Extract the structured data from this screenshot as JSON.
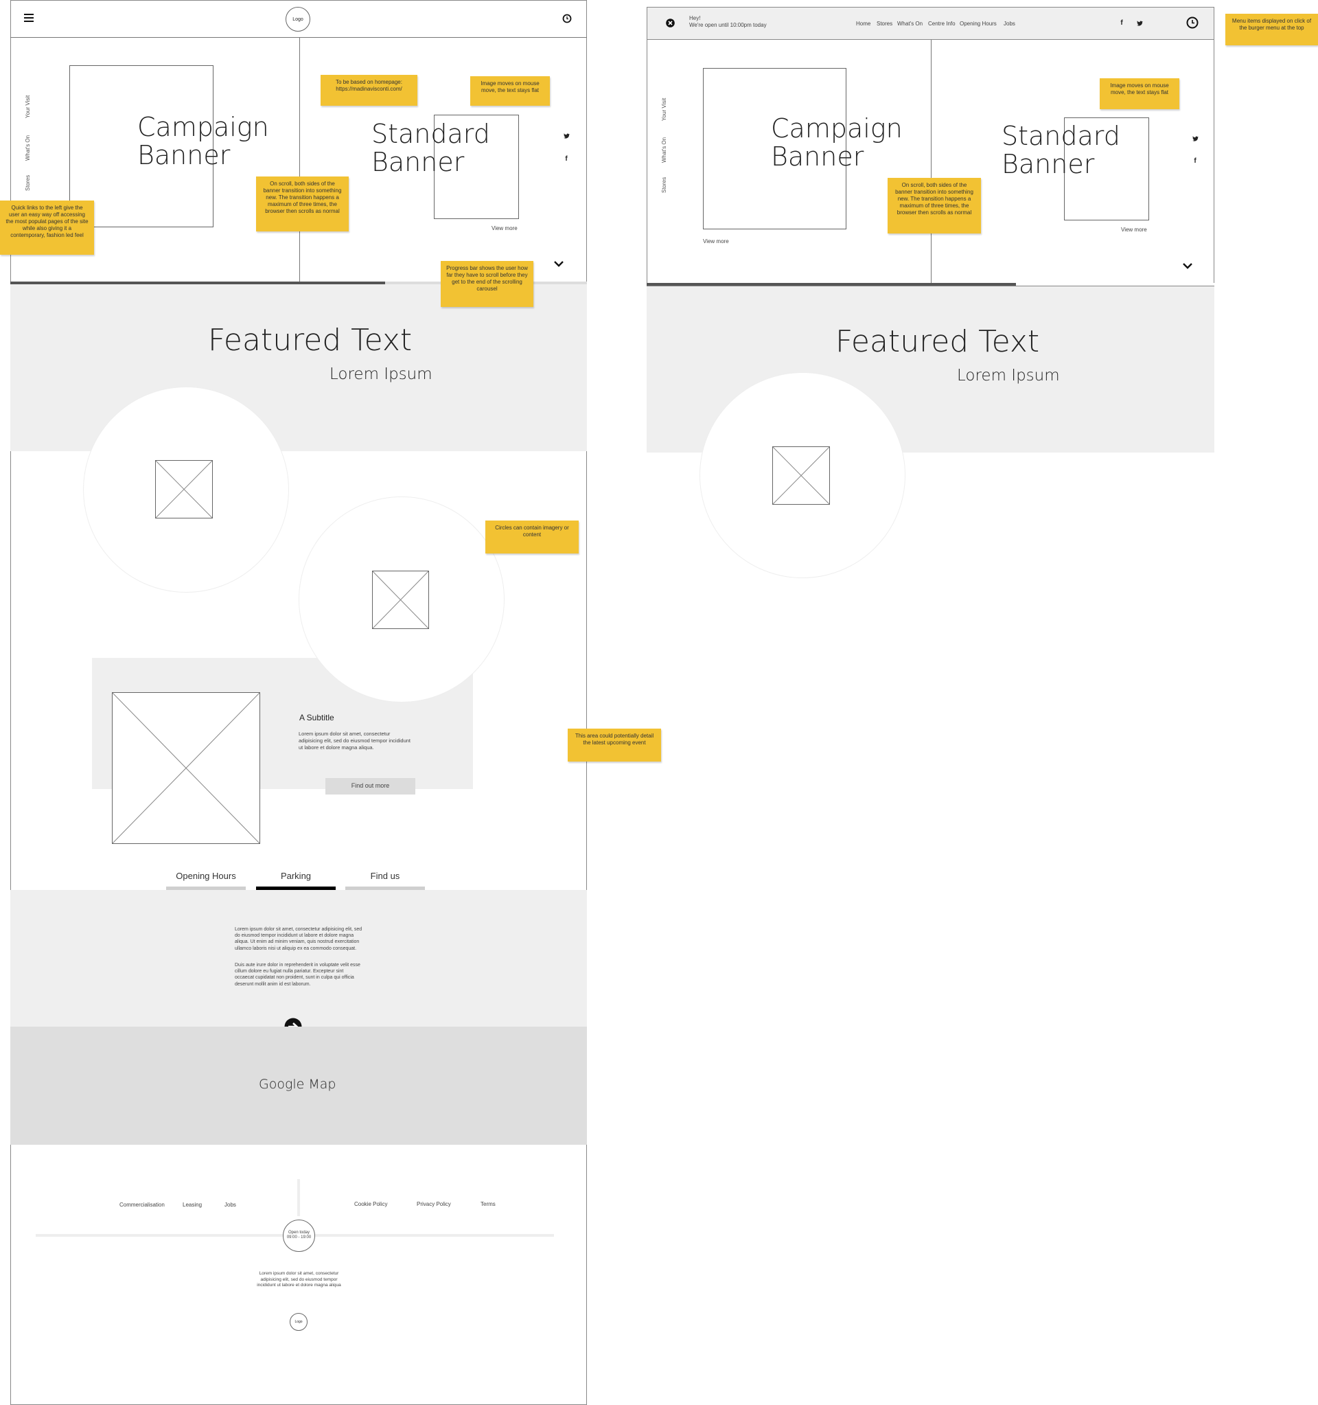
{
  "mobile": {
    "logo": "Logo",
    "campaign_title": "Campaign Banner",
    "standard_title": "Standard Banner",
    "view_more": "View more",
    "quick_links": [
      "Your Visit",
      "What's On",
      "Stores"
    ],
    "carousel_progress": 0.65,
    "featured_title": "Featured Text",
    "featured_sub": "Lorem Ipsum",
    "event": {
      "subtitle": "A Subtitle",
      "text": "Lorem ipsum dolor sit amet, consectetur adipisicing elit, sed do eiusmod tempor incididunt ut labore et dolore magna aliqua.",
      "button": "Find out more"
    },
    "tabs": [
      "Opening Hours",
      "Parking",
      "Find us"
    ],
    "tab_para1": "Lorem ipsum dolor sit amet, consectetur adipisicing elit, sed do eiusmod tempor incididunt ut labore et dolore magna aliqua. Ut enim ad minim veniam, quis nostrud exercitation ullamco laboris nisi ut aliquip ex ea commodo consequat.",
    "tab_para2": "Duis aute irure dolor in reprehenderit in voluptate velit esse cillum dolore eu fugiat nulla pariatur. Excepteur sint occaecat cupidatat non proident, sunt in culpa qui officia deserunt mollit anim id est laborum.",
    "map": "Google Map",
    "footer": {
      "left_links": [
        "Commercialisation",
        "Leasing",
        "Jobs"
      ],
      "right_links": [
        "Cookie Policy",
        "Privacy Policy",
        "Terms"
      ],
      "open_today": "Open today",
      "hours": "09:00 - 19:00",
      "text": "Lorem ipsum dolor sit amet, consectetur adipisicing elit, sed do eiusmod tempor incididunt ut labore et dolore magna aliqua",
      "logo": "Logo"
    }
  },
  "desktop": {
    "greeting": "Hey!",
    "open_text": "We're open until 10:00pm today",
    "nav": [
      "Home",
      "Stores",
      "What's On",
      "Centre Info",
      "Opening Hours",
      "Jobs"
    ],
    "campaign_title": "Campaign Banner",
    "standard_title": "Standard Banner",
    "view_more": "View more",
    "quick_links": [
      "Your Visit",
      "What's On",
      "Stores"
    ],
    "carousel_progress": 0.65,
    "featured_title": "Featured Text",
    "featured_sub": "Lorem Ipsum"
  },
  "notes": {
    "homepage": "To be based on homepage: https://madinavisconti.com/",
    "mouse": "Image moves on mouse move, the text stays flat",
    "scroll": "On scroll, both sides of the banner transition into something new. The transition happens a maximum of three times, the browser then scrolls as normal",
    "quick": "Quick links to the left give the user an easy way off accessing the most populat pages of the site while also giving it a contemporary, fashion led feel",
    "progress": "Progress bar shows the user how far they have to scroll before they get to the end of the scrolling carousel",
    "circles": "Circles can contain imagery or content",
    "event": "This area could potentially detail the latest upcoming event",
    "menu": "Menu items displayed on click of the burger menu at the top"
  },
  "colors": {
    "sticky": "#f2c233",
    "panel": "#efefef",
    "map": "#dedede"
  }
}
